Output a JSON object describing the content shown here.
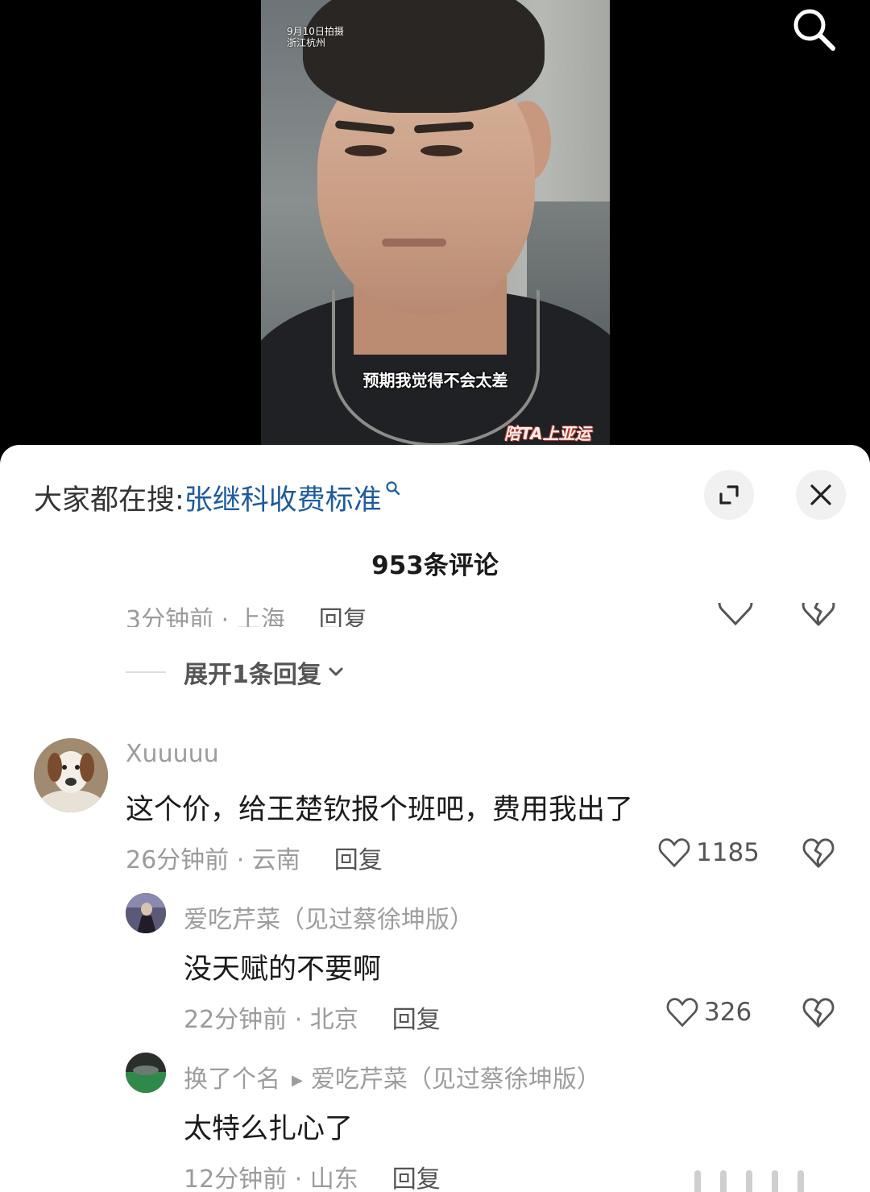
{
  "video": {
    "stamp_line1": "9月10日拍摄",
    "stamp_line2": "浙江杭州",
    "caption": "预期我觉得不会太差",
    "logo_text": "陪TA上亚运",
    "search_icon": "search-icon"
  },
  "sheet": {
    "trend_prefix": "大家都在搜:",
    "trend_query": "张继科收费标准",
    "comment_count": "953条评论",
    "expand_icon": "collapse-icon",
    "close_icon": "close-icon"
  },
  "partial_comment": {
    "meta": "3分钟前 · 上海",
    "reply_label": "回复",
    "expand_label": "展开1条回复"
  },
  "comments": [
    {
      "username": "Xuuuuu",
      "text": "这个价，给王楚钦报个班吧，费用我出了",
      "meta": "26分钟前 · 云南",
      "reply_label": "回复",
      "likes": "1185"
    }
  ],
  "replies": [
    {
      "username": "爱吃芹菜（见过蔡徐坤版）",
      "text": "没天赋的不要啊",
      "meta": "22分钟前 · 北京",
      "reply_label": "回复",
      "likes": "326"
    },
    {
      "username": "换了个名",
      "reply_to": "爱吃芹菜（见过蔡徐坤版）",
      "text": "太特么扎心了",
      "meta": "12分钟前 · 山东",
      "reply_label": "回复"
    }
  ],
  "colors": {
    "link": "#1e5b9e",
    "muted": "#9b9b9b",
    "text": "#1b1b1b",
    "sheet_bg": "#ffffff"
  }
}
